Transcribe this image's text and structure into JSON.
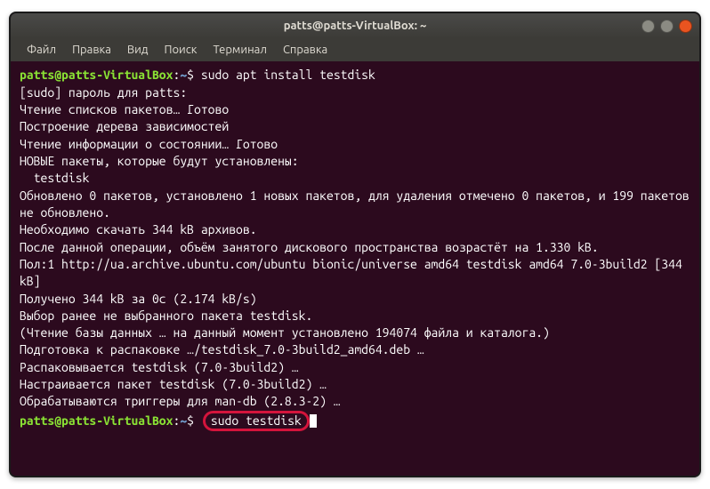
{
  "window": {
    "title": "patts@patts-VirtualBox: ~"
  },
  "menu": {
    "items": [
      "Файл",
      "Правка",
      "Вид",
      "Поиск",
      "Терминал",
      "Справка"
    ]
  },
  "prompt": {
    "user_host": "patts@patts-VirtualBox",
    "colon": ":",
    "path": "~",
    "symbol": "$"
  },
  "commands": {
    "cmd1": " sudo apt install testdisk",
    "cmd2": "sudo testdisk"
  },
  "output": {
    "l1": "[sudo] пароль для patts:",
    "l2": "Чтение списков пакетов… Готово",
    "l3": "Построение дерева зависимостей",
    "l4": "Чтение информации о состоянии… Готово",
    "l5": "НОВЫЕ пакеты, которые будут установлены:",
    "l6": "  testdisk",
    "l7": "Обновлено 0 пакетов, установлено 1 новых пакетов, для удаления отмечено 0 пакетов, и 199 пакетов не обновлено.",
    "l8": "Необходимо скачать 344 kB архивов.",
    "l9": "После данной операции, объём занятого дискового пространства возрастёт на 1.330 kB.",
    "l10": "Пол:1 http://ua.archive.ubuntu.com/ubuntu bionic/universe amd64 testdisk amd64 7.0-3build2 [344 kB]",
    "l11": "Получено 344 kB за 0с (2.174 kB/s)",
    "l12": "Выбор ранее не выбранного пакета testdisk.",
    "l13": "(Чтение базы данных … на данный момент установлено 194074 файла и каталога.)",
    "l14": "Подготовка к распаковке …/testdisk_7.0-3build2_amd64.deb …",
    "l15": "Распаковывается testdisk (7.0-3build2) …",
    "l16": "Настраивается пакет testdisk (7.0-3build2) …",
    "l17": "Обрабатываются триггеры для man-db (2.8.3-2) …"
  }
}
